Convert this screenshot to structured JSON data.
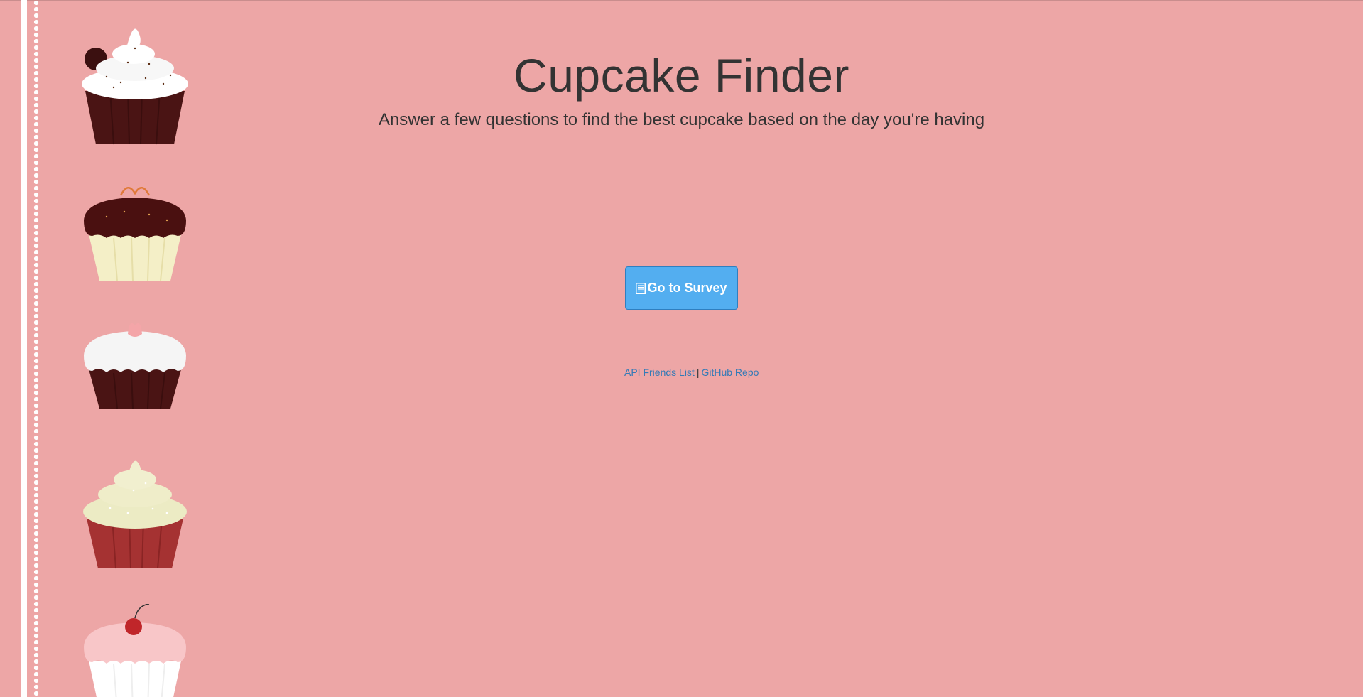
{
  "header": {
    "title": "Cupcake Finder",
    "subtitle": "Answer a few questions to find the best cupcake based on the day you're having"
  },
  "actions": {
    "survey_button_label": "Go to Survey",
    "survey_button_icon": "list-document-icon"
  },
  "links": {
    "api_friends": "API Friends List",
    "separator": "|",
    "github": "GitHub Repo"
  },
  "sidebar": {
    "cupcakes": [
      {
        "name": "cupcake-white-frosting-chocolate-icon"
      },
      {
        "name": "cupcake-chocolate-frosting-vanilla-icon"
      },
      {
        "name": "cupcake-white-frosting-flower-icon"
      },
      {
        "name": "cupcake-cream-frosting-red-velvet-icon"
      },
      {
        "name": "cupcake-pink-frosting-cherry-icon"
      }
    ]
  },
  "colors": {
    "background": "#eda6a6",
    "button": "#53aef0",
    "link": "#337ab7",
    "text": "#333333"
  }
}
